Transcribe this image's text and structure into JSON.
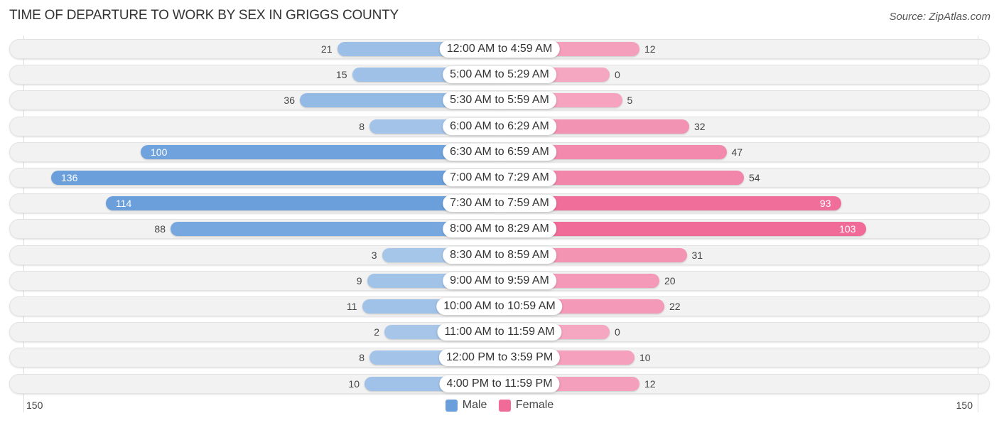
{
  "chart_data": {
    "type": "bar",
    "orientation": "horizontal-diverging",
    "title": "TIME OF DEPARTURE TO WORK BY SEX IN GRIGGS COUNTY",
    "source": "Source: ZipAtlas.com",
    "categories": [
      "12:00 AM to 4:59 AM",
      "5:00 AM to 5:29 AM",
      "5:30 AM to 5:59 AM",
      "6:00 AM to 6:29 AM",
      "6:30 AM to 6:59 AM",
      "7:00 AM to 7:29 AM",
      "7:30 AM to 7:59 AM",
      "8:00 AM to 8:29 AM",
      "8:30 AM to 8:59 AM",
      "9:00 AM to 9:59 AM",
      "10:00 AM to 10:59 AM",
      "11:00 AM to 11:59 AM",
      "12:00 PM to 3:59 PM",
      "4:00 PM to 11:59 PM"
    ],
    "series": [
      {
        "name": "Male",
        "color": "#6a9fdc",
        "color_light": "#a7c6e9",
        "values": [
          21,
          15,
          36,
          8,
          100,
          136,
          114,
          88,
          3,
          9,
          11,
          2,
          8,
          10
        ]
      },
      {
        "name": "Female",
        "color": "#f06b97",
        "color_light": "#f5a6c0",
        "values": [
          12,
          0,
          5,
          32,
          47,
          54,
          93,
          103,
          31,
          20,
          22,
          0,
          10,
          12
        ]
      }
    ],
    "axis": {
      "left_tick": "150",
      "right_tick": "150",
      "xlim": [
        -150,
        150
      ]
    },
    "legend": {
      "position": "bottom-center",
      "items": [
        "Male",
        "Female"
      ]
    },
    "grid": false
  }
}
